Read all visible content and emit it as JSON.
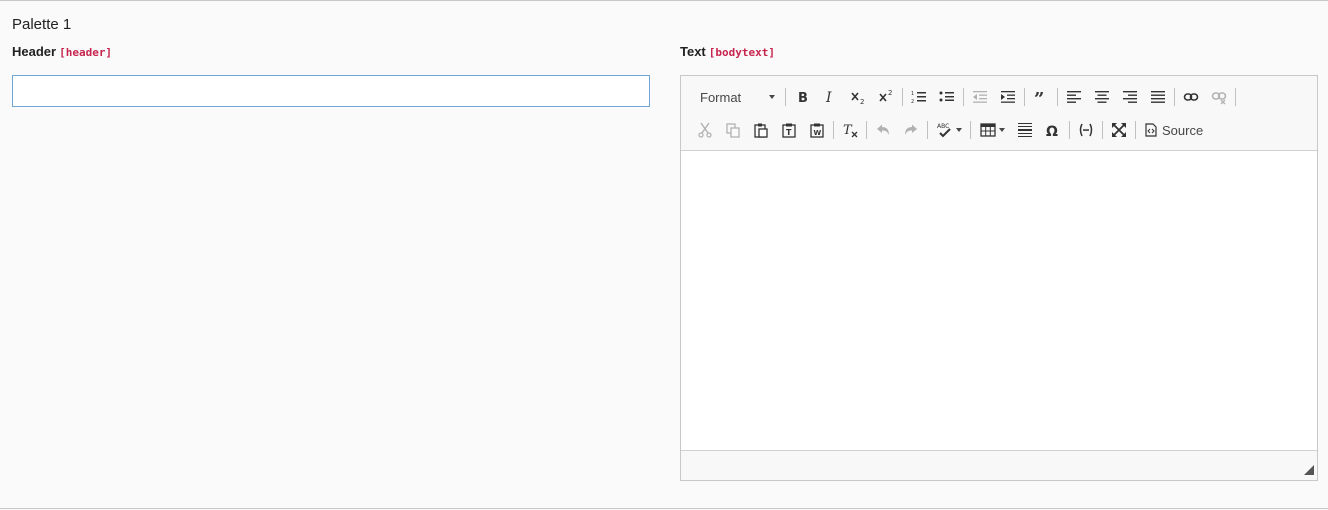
{
  "palette": {
    "title": "Palette 1"
  },
  "fields": {
    "header": {
      "label": "Header",
      "name": "[header]",
      "value": "",
      "placeholder": ""
    },
    "bodytext": {
      "label": "Text",
      "name": "[bodytext]"
    }
  },
  "toolbar": {
    "format_label": "Format",
    "source_label": "Source",
    "row1": [
      "bold-icon",
      "italic-icon",
      "subscript-icon",
      "superscript-icon",
      "numbered-list-icon",
      "bulleted-list-icon",
      "outdent-icon",
      "indent-icon",
      "blockquote-icon",
      "align-left-icon",
      "align-center-icon",
      "align-right-icon",
      "justify-icon",
      "link-icon",
      "unlink-icon"
    ],
    "row2": [
      "cut-icon",
      "copy-icon",
      "paste-icon",
      "paste-text-icon",
      "paste-word-icon",
      "remove-format-icon",
      "undo-icon",
      "redo-icon",
      "spellcheck-icon",
      "table-icon",
      "horizontal-rule-icon",
      "special-char-icon",
      "soft-hyphen-icon",
      "maximize-icon",
      "source-icon"
    ]
  },
  "colors": {
    "accent_field_name": "#c7254e",
    "input_focus_border": "#6ea6d6"
  }
}
